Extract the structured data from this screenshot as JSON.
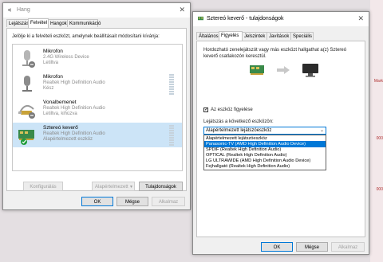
{
  "background": {
    "marks": [
      "Mark",
      "000",
      "000"
    ]
  },
  "hang": {
    "title": "Hang",
    "close_glyph": "✕",
    "tabs": [
      "Lejátszás",
      "Felvétel",
      "Hangok",
      "Kommunikáció"
    ],
    "active_tab": 1,
    "instruction": "Jelölje ki a felvételi eszközt, amelynek beállításait módosítani kívánja:",
    "devices": [
      {
        "name": "Mikrofon",
        "line2": "2.4G Wireless Device",
        "line3": "Letiltva",
        "icon": "microphone-icon"
      },
      {
        "name": "Mikrofon",
        "line2": "Realtek High Definition Audio",
        "line3": "Kész",
        "icon": "microphone-icon"
      },
      {
        "name": "Vonalbemenet",
        "line2": "Realtek High Definition Audio",
        "line3": "Letiltva, kihúzva",
        "icon": "line-in-icon"
      },
      {
        "name": "Sztereó keverő",
        "line2": "Realtek High Definition Audio",
        "line3": "Alapértelmezett eszköz",
        "icon": "stereo-mix-icon"
      }
    ],
    "selected_device": 3,
    "buttons": {
      "configure": "Konfigurálás",
      "set_default": "Alapértelmezett",
      "properties": "Tulajdonságok",
      "ok": "OK",
      "cancel": "Mégse",
      "apply": "Alkalmaz"
    }
  },
  "props": {
    "title": "Sztereó keverő - tulajdonságok",
    "close_glyph": "✕",
    "tabs": [
      "Általános",
      "Figyelés",
      "Jelszintek",
      "Javítások",
      "Speciális"
    ],
    "active_tab": 1,
    "description_line1": "Hordozható zenelejátszót vagy más eszközt hallgathat a(z) Sztereó",
    "description_line2": "keverő csatlakozón keresztül.",
    "listen_checkbox": {
      "label": "Az eszköz figyelése",
      "checked": true,
      "glyph": "✓"
    },
    "playback_label": "Lejátszás a következő eszközön:",
    "combo_value": "Alapértelmezett lejátszóeszköz",
    "combo_arrow": "⌄",
    "dropdown_options": [
      "Alapértelmezett lejátszóeszköz",
      "Panasonic-TV (AMD High Definition Audio Device)",
      "SPDIF (Realtek High Definition Audio)",
      "OPTICAL (Realtek High Definition Audio)",
      "LG ULTRAWIDE (AMD High Definition Audio Device)",
      "Fejhallgató (Realtek High Definition Audio)"
    ],
    "highlighted_option": 1,
    "buttons": {
      "ok": "OK",
      "cancel": "Mégse",
      "apply": "Alkalmaz"
    }
  },
  "colors": {
    "accent": "#0078d7",
    "selection": "#cce4f7",
    "check_green": "#1e9c3a"
  }
}
